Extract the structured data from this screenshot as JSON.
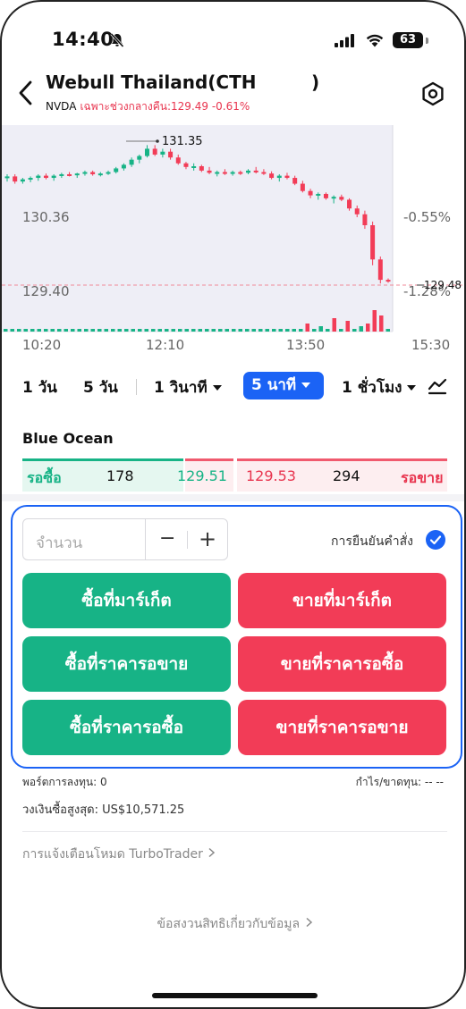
{
  "status_bar": {
    "time": "14:40",
    "battery": "63"
  },
  "header": {
    "title": "Webull Thailand(CTH",
    "title_close": ")",
    "ticker": "NVDA",
    "quote": "เฉพาะช่วงกลางคืน:129.49 -0.61%"
  },
  "chart": {
    "high_label": "131.35",
    "left_labels": [
      "130.36",
      "129.40"
    ],
    "right_labels": [
      "-0.55%",
      "-1.28%"
    ],
    "last_price": "129.48",
    "x_labels": [
      "10:20",
      "12:10",
      "13:50",
      "15:30"
    ],
    "colors": {
      "up": "#17b386",
      "down": "#f23c57",
      "shade": "#eeeef6"
    }
  },
  "chart_data": {
    "type": "candlestick",
    "title": "",
    "x_ticks": [
      "10:20",
      "12:10",
      "13:50",
      "15:30"
    ],
    "y_ticks": [
      "130.36",
      "129.40"
    ],
    "y_percent_ticks": [
      "-0.55%",
      "-1.28%"
    ],
    "ylim": [
      128.9,
      131.6
    ],
    "annotations": [
      {
        "label": "131.35",
        "type": "high"
      },
      {
        "label": "129.48",
        "type": "last"
      }
    ],
    "series": [
      {
        "values": [
          [
            130.9,
            130.95,
            130.85,
            130.92
          ],
          [
            130.92,
            130.95,
            130.82,
            130.85
          ],
          [
            130.85,
            130.9,
            130.82,
            130.88
          ],
          [
            130.88,
            130.92,
            130.84,
            130.9
          ],
          [
            130.9,
            130.95,
            130.86,
            130.93
          ],
          [
            130.93,
            130.96,
            130.88,
            130.9
          ],
          [
            130.9,
            130.95,
            130.86,
            130.93
          ],
          [
            130.93,
            130.97,
            130.9,
            130.95
          ],
          [
            130.95,
            130.98,
            130.92,
            130.94
          ],
          [
            130.94,
            130.97,
            130.9,
            130.96
          ],
          [
            130.96,
            131.0,
            130.93,
            130.98
          ],
          [
            130.98,
            131.0,
            130.93,
            130.95
          ],
          [
            130.95,
            130.98,
            130.92,
            130.96
          ],
          [
            130.96,
            131.0,
            130.94,
            130.98
          ],
          [
            130.98,
            131.05,
            130.96,
            131.03
          ],
          [
            131.03,
            131.1,
            131.0,
            131.08
          ],
          [
            131.08,
            131.18,
            131.05,
            131.15
          ],
          [
            131.15,
            131.22,
            131.1,
            131.2
          ],
          [
            131.2,
            131.35,
            131.18,
            131.3
          ],
          [
            131.3,
            131.35,
            131.2,
            131.22
          ],
          [
            131.22,
            131.3,
            131.18,
            131.26
          ],
          [
            131.26,
            131.3,
            131.15,
            131.18
          ],
          [
            131.18,
            131.22,
            131.08,
            131.1
          ],
          [
            131.1,
            131.12,
            131.02,
            131.05
          ],
          [
            131.05,
            131.1,
            131.0,
            131.06
          ],
          [
            131.06,
            131.08,
            130.98,
            131.0
          ],
          [
            131.0,
            131.05,
            130.95,
            130.97
          ],
          [
            130.97,
            131.0,
            130.92,
            130.98
          ],
          [
            130.98,
            131.02,
            130.94,
            130.96
          ],
          [
            130.96,
            131.0,
            130.93,
            130.98
          ],
          [
            130.98,
            131.0,
            130.94,
            130.97
          ],
          [
            130.97,
            131.02,
            130.95,
            131.0
          ],
          [
            131.0,
            131.05,
            130.96,
            130.98
          ],
          [
            130.98,
            131.02,
            130.94,
            130.96
          ],
          [
            130.96,
            130.99,
            130.88,
            130.9
          ],
          [
            130.9,
            130.95,
            130.85,
            130.93
          ],
          [
            130.93,
            130.97,
            130.88,
            130.9
          ],
          [
            130.9,
            130.93,
            130.8,
            130.82
          ],
          [
            130.82,
            130.86,
            130.7,
            130.72
          ],
          [
            130.72,
            130.75,
            130.62,
            130.66
          ],
          [
            130.66,
            130.7,
            130.6,
            130.68
          ],
          [
            130.68,
            130.7,
            130.6,
            130.62
          ],
          [
            130.62,
            130.66,
            130.55,
            130.64
          ],
          [
            130.64,
            130.67,
            130.58,
            130.6
          ],
          [
            130.6,
            130.62,
            130.45,
            130.48
          ],
          [
            130.48,
            130.52,
            130.36,
            130.4
          ],
          [
            130.4,
            130.45,
            130.2,
            130.25
          ],
          [
            130.25,
            130.3,
            129.7,
            129.78
          ],
          [
            129.78,
            129.82,
            129.45,
            129.5
          ],
          [
            129.5,
            129.52,
            129.46,
            129.48
          ]
        ],
        "volume": [
          1,
          1,
          1,
          1,
          1,
          1,
          1,
          1,
          1,
          1,
          1,
          1,
          1,
          1,
          1,
          1,
          1,
          1,
          1,
          1,
          1,
          1,
          1,
          1,
          1,
          1,
          1,
          1,
          1,
          1,
          1,
          1,
          1,
          1,
          1,
          1,
          1,
          1,
          1,
          1,
          1,
          1,
          1,
          1,
          1,
          3,
          1,
          2,
          1,
          5,
          1,
          4,
          1,
          2,
          3,
          8,
          6,
          1
        ]
      }
    ]
  },
  "interval_tabs": [
    {
      "label": "1 วัน",
      "selected": false
    },
    {
      "label": "5 วัน",
      "selected": false
    },
    {
      "label": "1 วินาที",
      "selected": false,
      "dropdown": true
    },
    {
      "label": "5 นาที",
      "selected": true,
      "dropdown": true
    },
    {
      "label": "1 ชั่วโมง",
      "selected": false,
      "dropdown": true
    }
  ],
  "level1": {
    "title": "Blue Ocean",
    "bid_label": "รอซื้อ",
    "bid_size": "178",
    "bid_price": "129.51",
    "ask_price": "129.53",
    "ask_size": "294",
    "ask_label": "รอขาย"
  },
  "order_panel": {
    "quantity_placeholder": "จำนวน",
    "minus": "−",
    "plus": "+",
    "confirm_label": "การยืนยันคำสั่ง",
    "confirm_checked": true,
    "buttons": {
      "buy_market": "ซื้อที่มาร์เก็ต",
      "sell_market": "ขายที่มาร์เก็ต",
      "buy_at_ask": "ซื้อที่ราคารอขาย",
      "sell_at_bid": "ขายที่ราคารอซื้อ",
      "buy_at_bid": "ซื้อที่ราคารอซื้อ",
      "sell_at_ask": "ขายที่ราคารอขาย"
    }
  },
  "footer": {
    "position": "พอร์ตการลงทุน: 0",
    "pnl": "กำไร/ขาดทุน: -- --",
    "buying_power": "วงเงินซื้อสูงสุด: US$10,571.25",
    "turbo": "การแจ้งเตือนโหมด TurboTrader",
    "disclaimer": "ข้อสงวนสิทธิเกี่ยวกับข้อมูล"
  }
}
